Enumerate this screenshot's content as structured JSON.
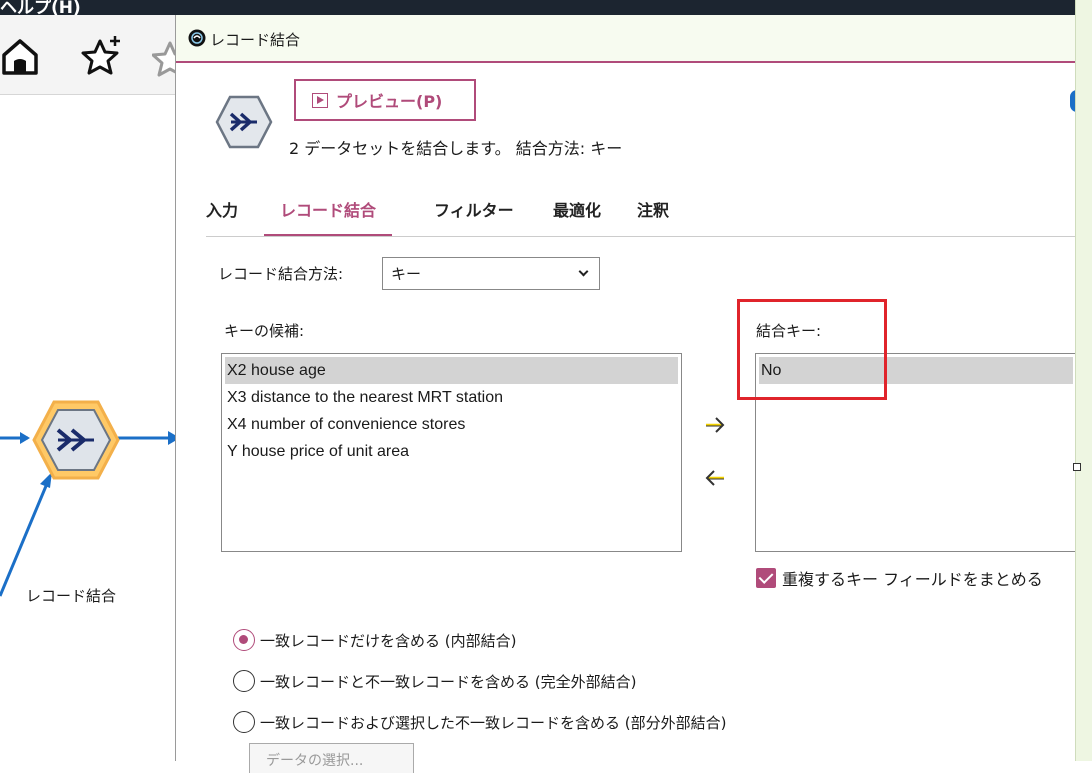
{
  "app": {
    "menu_text": "ヘルプ(H)",
    "canvas_node_label": "レコード結合"
  },
  "dialog": {
    "title": "レコード結合",
    "preview_label": "プレビュー(P)",
    "description": "2 データセットを結合します。 結合方法: キー",
    "tabs": [
      {
        "label": "入力"
      },
      {
        "label": "レコード結合",
        "active": true
      },
      {
        "label": "フィルター"
      },
      {
        "label": "最適化"
      },
      {
        "label": "注釈"
      }
    ],
    "method": {
      "label": "レコード結合方法:",
      "value": "キー"
    },
    "candidates": {
      "label": "キーの候補:",
      "items": [
        "X2 house age",
        "X3 distance to the nearest MRT station",
        "X4 number of convenience stores",
        "Y house price of unit area"
      ]
    },
    "keys": {
      "label": "結合キー:",
      "items": [
        "No"
      ]
    },
    "merge_duplicates": {
      "label": "重複するキー フィールドをまとめる",
      "checked": true
    },
    "join_options": [
      {
        "label": "一致レコードだけを含める (内部結合)",
        "checked": true
      },
      {
        "label": "一致レコードと不一致レコードを含める (完全外部結合)",
        "checked": false
      },
      {
        "label": "一致レコードおよび選択した不一致レコードを含める (部分外部結合)",
        "checked": false
      }
    ],
    "partial_select_button": "データの選択..."
  },
  "colors": {
    "accent": "#b04b7a",
    "highlight": "#e0242b",
    "node_fill": "#ffc966",
    "arrow_blue": "#1b6fc7"
  }
}
